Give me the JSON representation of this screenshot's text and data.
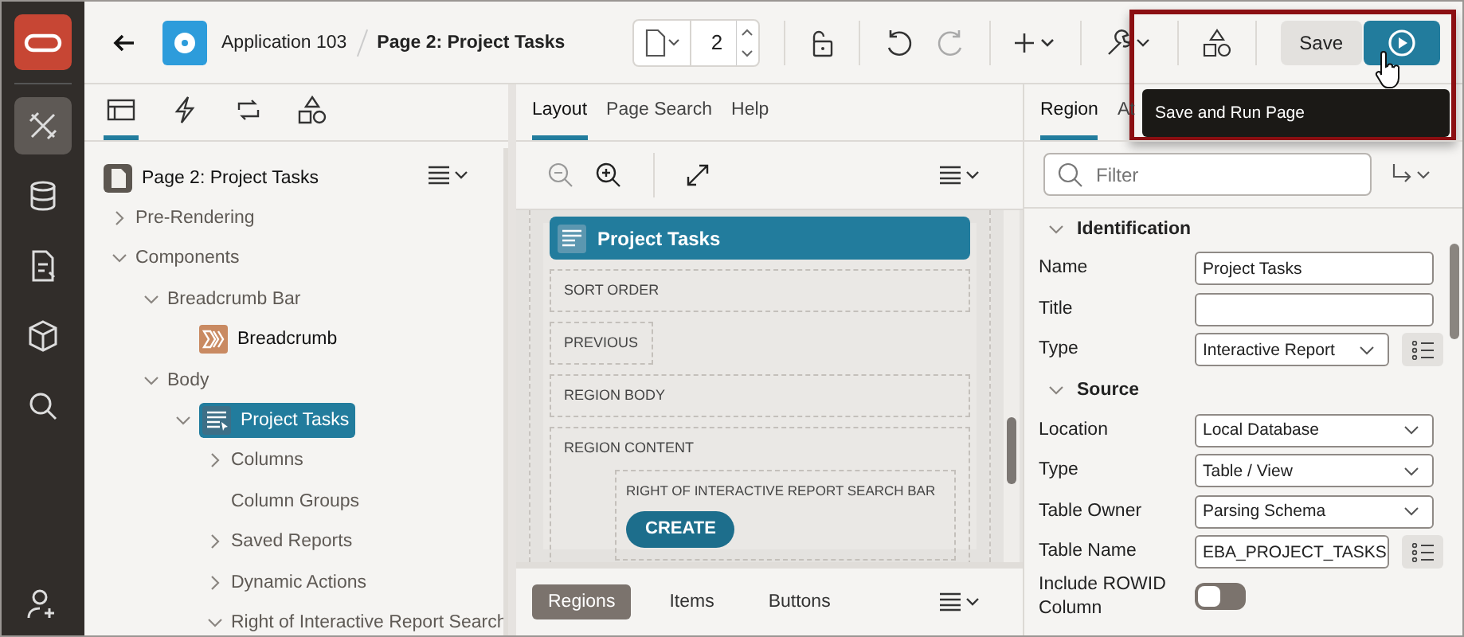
{
  "rail_items": [
    {
      "selected": true
    },
    {
      "selected": false
    },
    {
      "selected": false
    },
    {
      "selected": false
    },
    {
      "selected": false
    },
    {
      "selected": false
    }
  ],
  "header": {
    "app_title": "Application 103",
    "page_title": "Page 2: Project Tasks",
    "page_number": "2",
    "save_label": "Save",
    "tooltip": "Save and Run Page"
  },
  "left_tabs": [
    {
      "selected": true
    },
    {
      "selected": false
    },
    {
      "selected": false
    },
    {
      "selected": false
    }
  ],
  "tree": {
    "label": "Page 2: Project Tasks",
    "kind": "page",
    "selected": false,
    "children": [
      {
        "label": "Pre-Rendering",
        "kind": "group",
        "expanded": false,
        "selected": false
      },
      {
        "label": "Components",
        "kind": "group",
        "expanded": true,
        "selected": false,
        "children": [
          {
            "label": "Breadcrumb Bar",
            "kind": "group",
            "expanded": true,
            "selected": false,
            "children": [
              {
                "label": "Breadcrumb",
                "kind": "breadcrumb",
                "selected": false
              }
            ]
          },
          {
            "label": "Body",
            "kind": "group",
            "expanded": true,
            "selected": false,
            "children": [
              {
                "label": "Project Tasks",
                "kind": "region",
                "expanded": true,
                "selected": true,
                "children": [
                  {
                    "label": "Columns",
                    "kind": "group",
                    "expanded": false,
                    "selected": false
                  },
                  {
                    "label": "Column Groups",
                    "kind": "group",
                    "selected": false
                  },
                  {
                    "label": "Saved Reports",
                    "kind": "group",
                    "expanded": false,
                    "selected": false
                  },
                  {
                    "label": "Dynamic Actions",
                    "kind": "group",
                    "expanded": false,
                    "selected": false
                  },
                  {
                    "label": "Right of Interactive Report Search",
                    "kind": "group",
                    "expanded": true,
                    "selected": false
                  }
                ]
              }
            ]
          }
        ]
      }
    ]
  },
  "middle_tabs": [
    {
      "label": "Layout",
      "selected": true
    },
    {
      "label": "Page Search",
      "selected": false
    },
    {
      "label": "Help",
      "selected": false
    }
  ],
  "canvas": {
    "region_title": "Project Tasks",
    "slots": [
      "SORT ORDER",
      "PREVIOUS",
      "REGION BODY",
      "REGION CONTENT"
    ],
    "sub_slot": "RIGHT OF INTERACTIVE REPORT SEARCH BAR",
    "button": "CREATE"
  },
  "bottom_tabs": [
    {
      "label": "Regions",
      "selected": true
    },
    {
      "label": "Items",
      "selected": false
    },
    {
      "label": "Buttons",
      "selected": false
    }
  ],
  "right_tabs": [
    {
      "label": "Region",
      "selected": true
    },
    {
      "label": "At",
      "selected": false
    }
  ],
  "filter": {
    "placeholder": "Filter"
  },
  "sections": [
    {
      "title": "Identification",
      "expanded": true,
      "fields": [
        {
          "label": "Name",
          "kind": "text",
          "value": "Project Tasks",
          "picker": false
        },
        {
          "label": "Title",
          "kind": "text",
          "picker": false
        },
        {
          "label": "Type",
          "kind": "select",
          "value": "Interactive Report",
          "picker": true
        }
      ]
    },
    {
      "title": "Source",
      "expanded": true,
      "fields": [
        {
          "label": "Location",
          "kind": "select",
          "value": "Local Database",
          "picker": false
        },
        {
          "label": "Type",
          "kind": "select",
          "value": "Table / View",
          "picker": false
        },
        {
          "label": "Table Owner",
          "kind": "select",
          "value": "Parsing Schema",
          "picker": false
        },
        {
          "label": "Table Name",
          "kind": "text",
          "value": "EBA_PROJECT_TASKS",
          "picker": true
        },
        {
          "label": "Include ROWID Column",
          "kind": "switch",
          "on": false,
          "picker": false
        }
      ]
    }
  ]
}
